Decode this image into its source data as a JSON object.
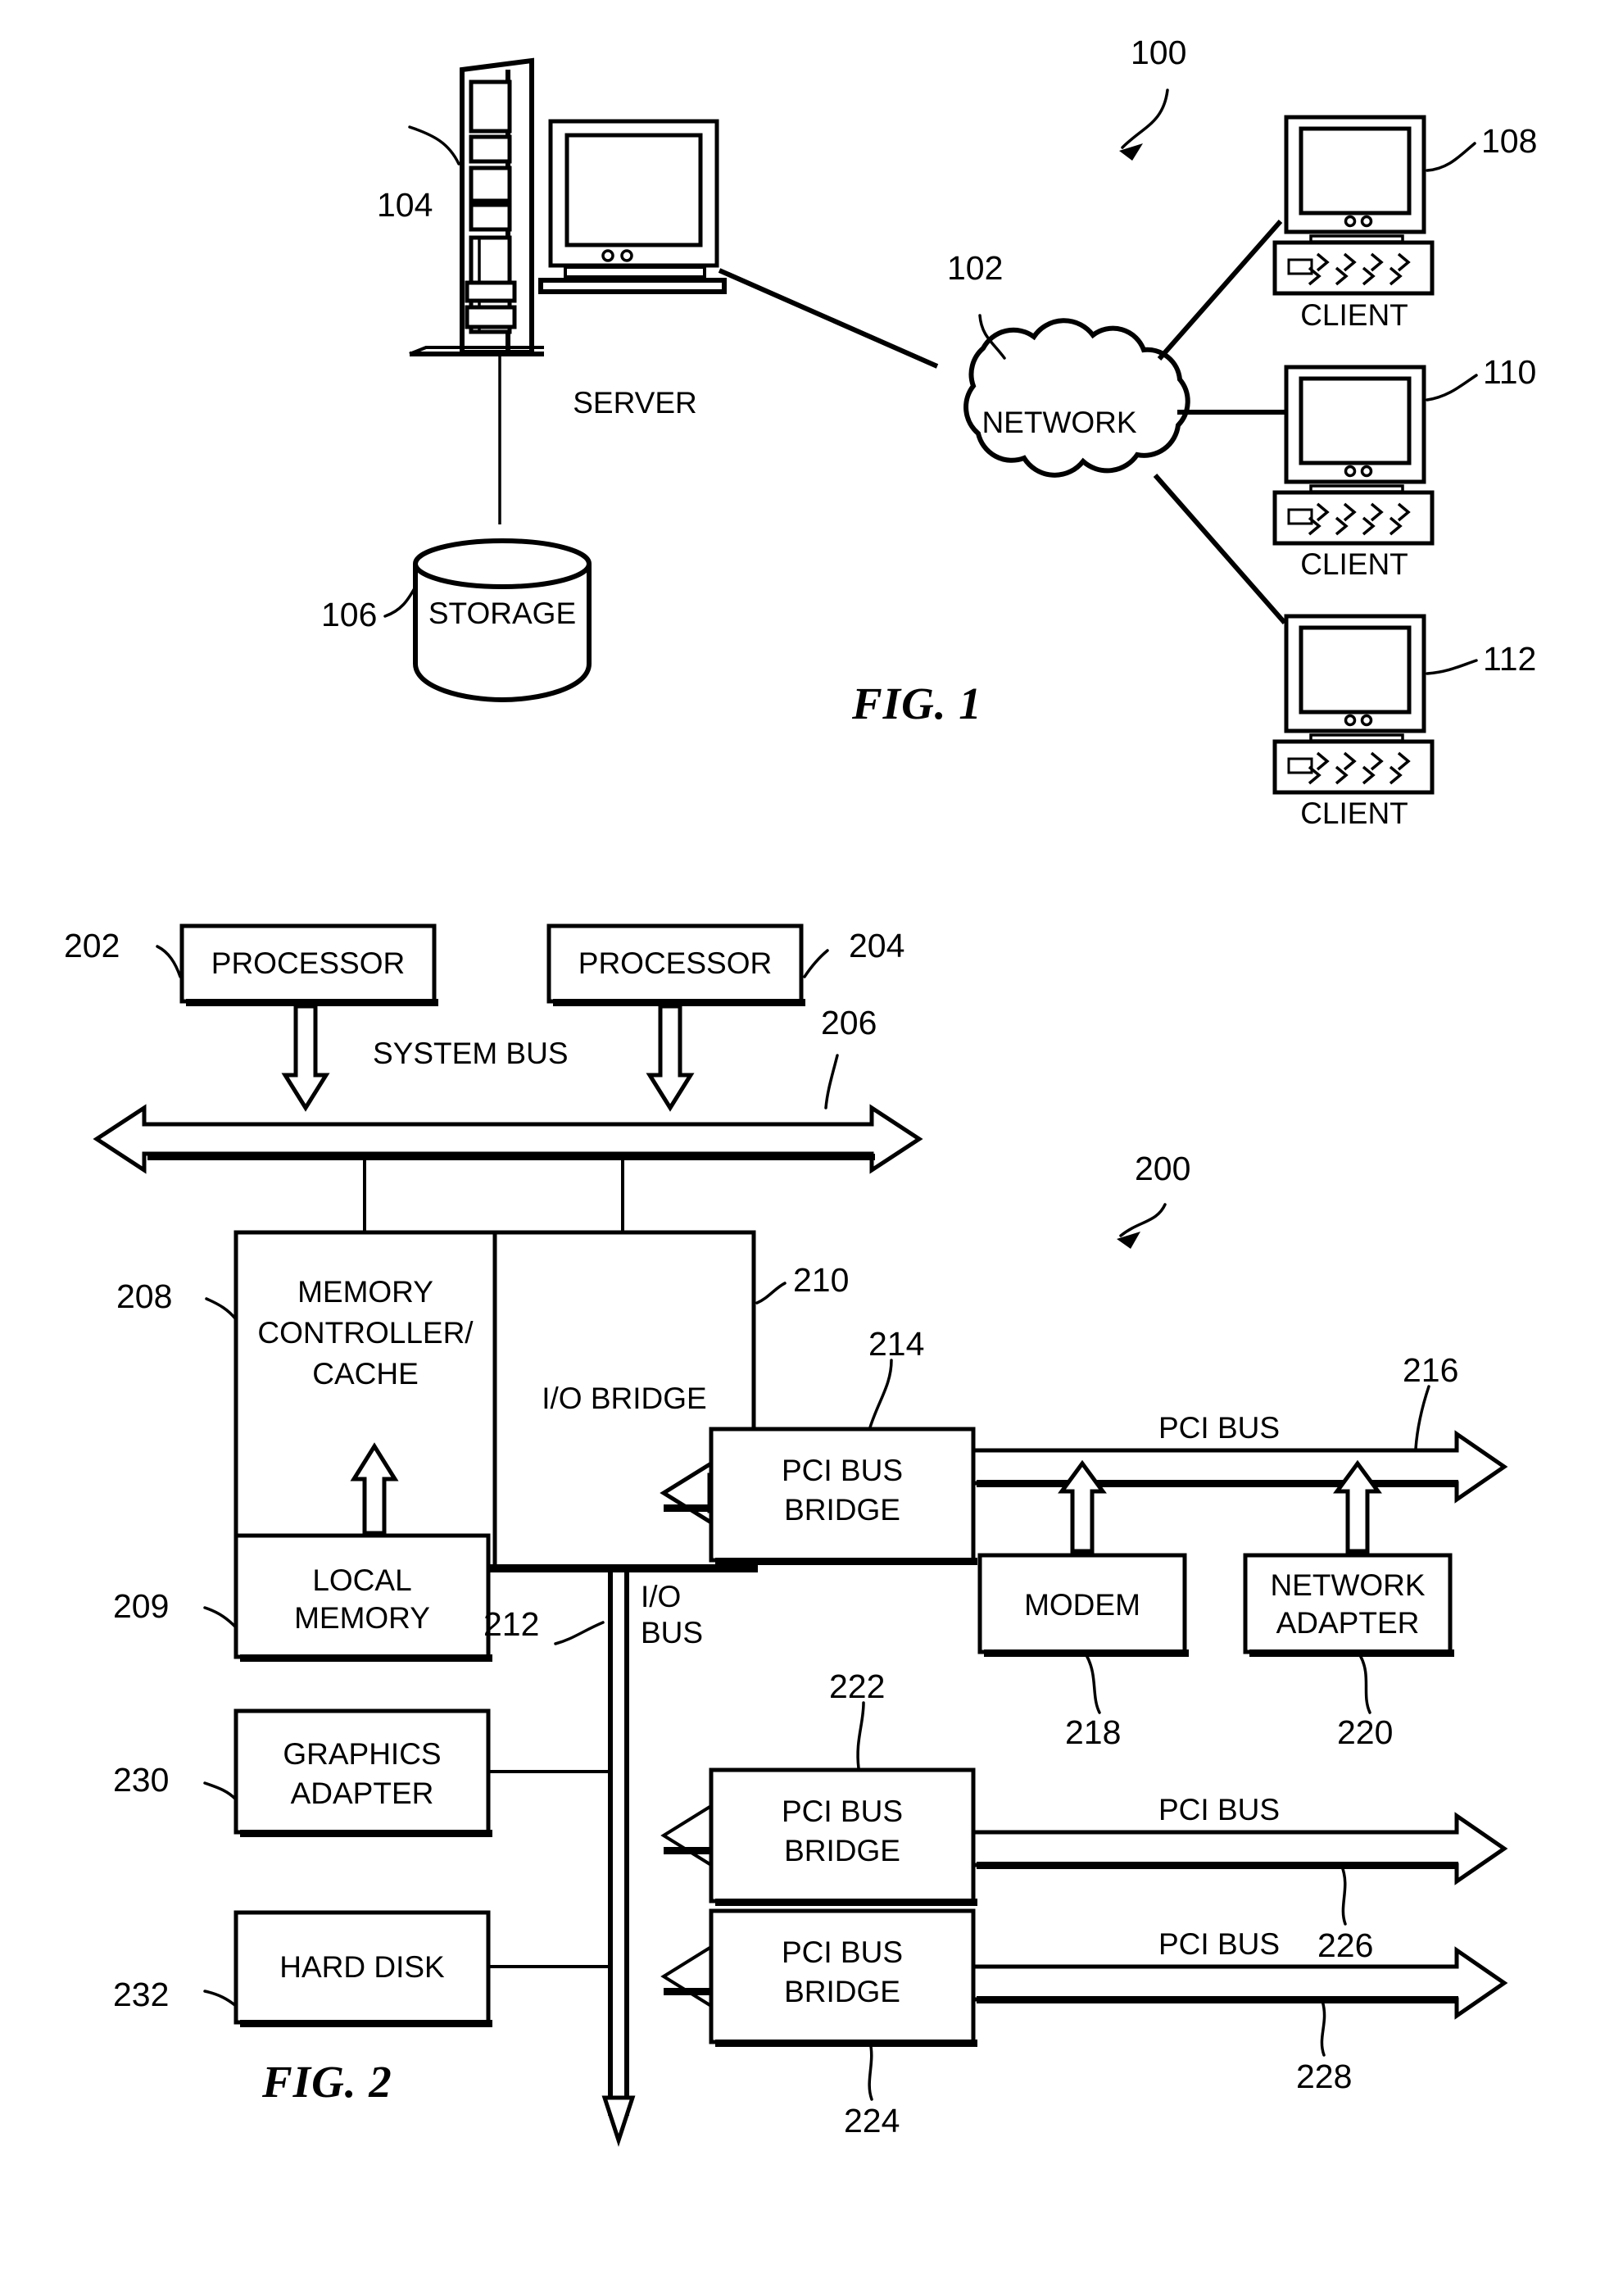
{
  "document": {
    "type": "patent-drawing-sheet",
    "figures": [
      "FIG. 1",
      "FIG. 2"
    ]
  },
  "fig1": {
    "caption": "FIG. 1",
    "system_ref": "100",
    "nodes": {
      "server": {
        "label": "SERVER",
        "ref": "104"
      },
      "storage": {
        "label": "STORAGE",
        "ref": "106"
      },
      "network": {
        "label": "NETWORK",
        "ref": "102"
      },
      "client1": {
        "label": "CLIENT",
        "ref": "108"
      },
      "client2": {
        "label": "CLIENT",
        "ref": "110"
      },
      "client3": {
        "label": "CLIENT",
        "ref": "112"
      }
    }
  },
  "fig2": {
    "caption": "FIG. 2",
    "system_ref": "200",
    "blocks": {
      "processor1": {
        "label": "PROCESSOR",
        "ref": "202"
      },
      "processor2": {
        "label": "PROCESSOR",
        "ref": "204"
      },
      "memory_controller": {
        "line1": "MEMORY",
        "line2": "CONTROLLER/",
        "line3": "CACHE",
        "ref": "208"
      },
      "io_bridge": {
        "label": "I/O BRIDGE",
        "ref": "210"
      },
      "local_memory": {
        "line1": "LOCAL",
        "line2": "MEMORY",
        "ref": "209"
      },
      "pci_bridge1": {
        "line1": "PCI BUS",
        "line2": "BRIDGE",
        "ref": "214"
      },
      "pci_bridge2": {
        "line1": "PCI BUS",
        "line2": "BRIDGE",
        "ref": "222"
      },
      "pci_bridge3": {
        "line1": "PCI BUS",
        "line2": "BRIDGE",
        "ref": "224"
      },
      "modem": {
        "label": "MODEM",
        "ref": "218"
      },
      "network_adapter": {
        "line1": "NETWORK",
        "line2": "ADAPTER",
        "ref": "220"
      },
      "graphics_adapter": {
        "line1": "GRAPHICS",
        "line2": "ADAPTER",
        "ref": "230"
      },
      "hard_disk": {
        "label": "HARD DISK",
        "ref": "232"
      }
    },
    "buses": {
      "system_bus": {
        "label": "SYSTEM BUS",
        "ref": "206"
      },
      "io_bus": {
        "line1": "I/O",
        "line2": "BUS",
        "ref": "212"
      },
      "pci_bus1": {
        "label": "PCI BUS",
        "ref": "216"
      },
      "pci_bus2": {
        "label": "PCI BUS",
        "ref": "226"
      },
      "pci_bus3": {
        "label": "PCI BUS",
        "ref": "228"
      }
    }
  },
  "colors": {
    "ink": "#000000",
    "paper": "#ffffff"
  }
}
